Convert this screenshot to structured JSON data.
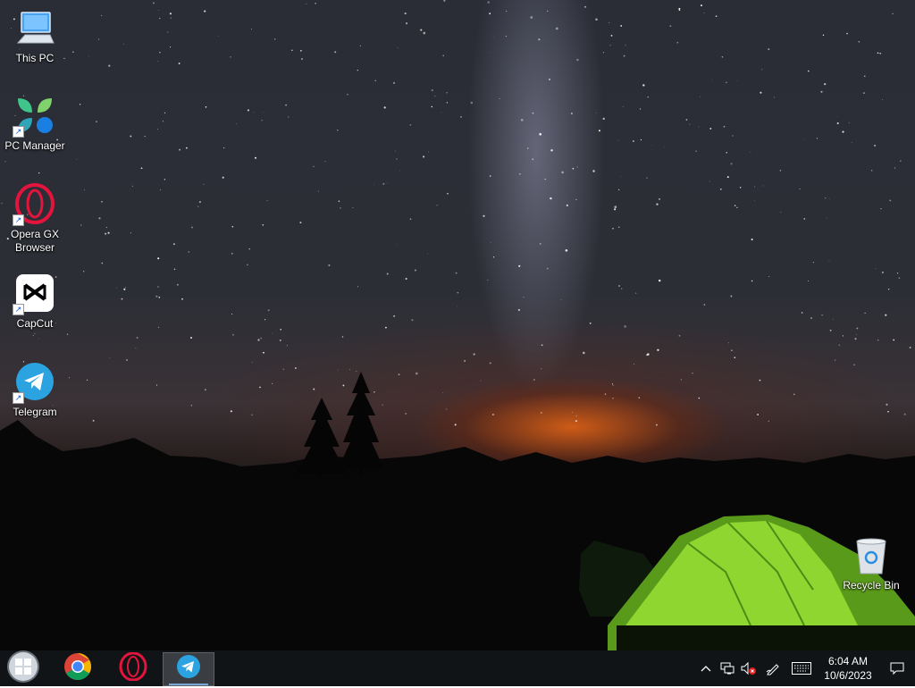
{
  "desktop": {
    "icons": [
      {
        "label": "This PC",
        "icon": "computer-icon"
      },
      {
        "label": "PC Manager",
        "icon": "pc-manager-icon"
      },
      {
        "label": "Opera GX Browser",
        "icon": "opera-gx-icon"
      },
      {
        "label": "CapCut",
        "icon": "capcut-icon"
      },
      {
        "label": "Telegram",
        "icon": "telegram-icon"
      },
      {
        "label": "Recycle Bin",
        "icon": "recycle-bin-icon"
      }
    ]
  },
  "taskbar": {
    "apps": [
      {
        "icon": "windows-start-icon",
        "running": false
      },
      {
        "icon": "chrome-icon",
        "running": false
      },
      {
        "icon": "opera-icon",
        "running": false
      },
      {
        "icon": "telegram-icon",
        "running": true,
        "active": true
      }
    ],
    "tray": {
      "icons": [
        "chevron-up-icon",
        "network-icon",
        "volume-muted-icon",
        "pen-icon",
        "keyboard-icon"
      ],
      "time": "6:04 AM",
      "date": "10/6/2023",
      "notification_icon": "notification-icon"
    }
  },
  "colors": {
    "taskbar_bg": "#101417",
    "opera_red": "#e4143c",
    "telegram_blue": "#2aa3e0"
  }
}
